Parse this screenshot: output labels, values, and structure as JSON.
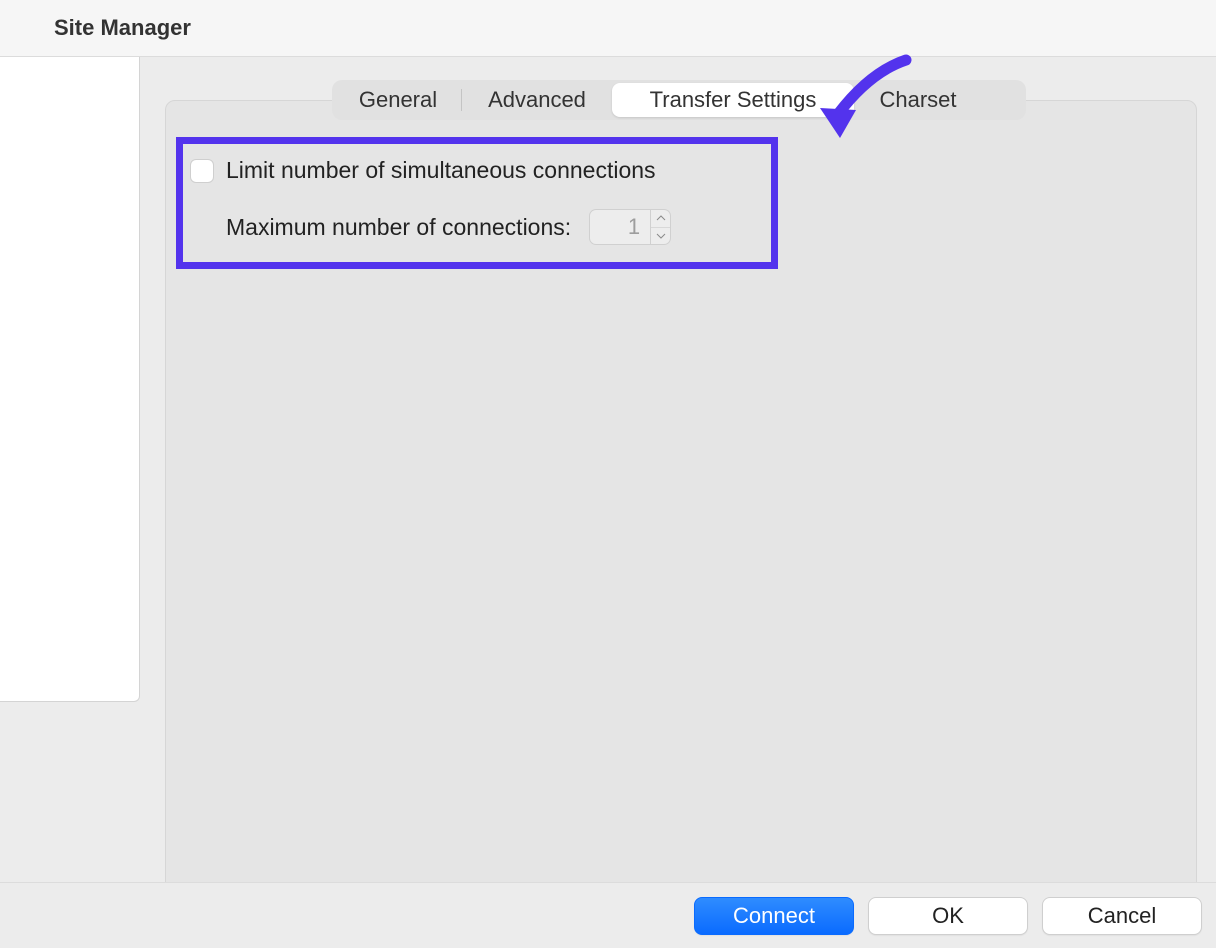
{
  "window": {
    "title": "Site Manager"
  },
  "tabs": {
    "items": [
      "General",
      "Advanced",
      "Transfer Settings",
      "Charset"
    ],
    "active_index": 2
  },
  "form": {
    "limit_checkbox_label": "Limit number of simultaneous connections",
    "limit_checked": false,
    "max_label": "Maximum number of connections:",
    "max_value": "1"
  },
  "buttons": {
    "connect": "Connect",
    "ok": "OK",
    "cancel": "Cancel"
  },
  "annotation": {
    "highlight_color": "#5333ed"
  }
}
